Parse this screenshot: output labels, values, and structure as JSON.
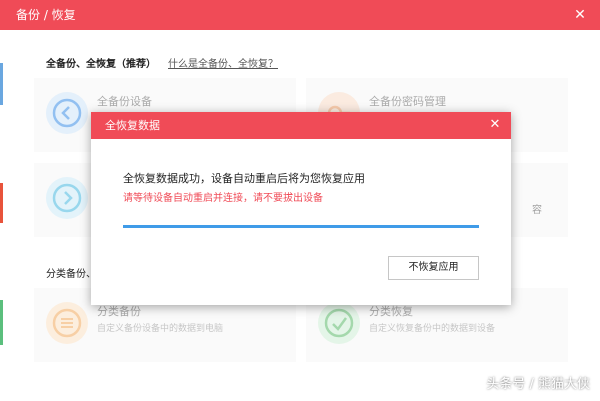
{
  "window": {
    "title": "备份 / 恢复",
    "close_glyph": "✕"
  },
  "sections": [
    {
      "title": "全备份、全恢复（推荐）",
      "help_link": "什么是全备份、全恢复？"
    },
    {
      "title": "分类备份、"
    }
  ],
  "cards": [
    {
      "title": "全备份设备",
      "description": "",
      "icon": "backup-arrow-icon",
      "color": "#3a8ee6"
    },
    {
      "title": "全备份密码管理",
      "description": "",
      "icon": "key-icon",
      "color": "#f0a068"
    },
    {
      "title": "",
      "description": "",
      "icon": "restore-arrow-icon",
      "color": "#45b8e0"
    },
    {
      "title": "",
      "description": "容",
      "icon": "",
      "color": "#cccccc"
    },
    {
      "title": "分类备份",
      "description": "自定义备份设备中的数据到电脑",
      "icon": "category-backup-icon",
      "color": "#f2a95c"
    },
    {
      "title": "分类恢复",
      "description": "自定义恢复备份中的数据到设备",
      "icon": "category-restore-icon",
      "color": "#5bb96a"
    }
  ],
  "dialog": {
    "title": "全恢复数据",
    "close_glyph": "✕",
    "message": "全恢复数据成功，设备自动重启后将为您恢复应用",
    "warning": "请等待设备自动重启并连接，请不要拔出设备",
    "progress": 1.0,
    "button_label": "不恢复应用"
  },
  "watermark": "头条号 / 熊猫大侠",
  "colors": {
    "accent": "#f04b57",
    "progress": "#3f9be8",
    "warning_text": "#f04b57"
  }
}
